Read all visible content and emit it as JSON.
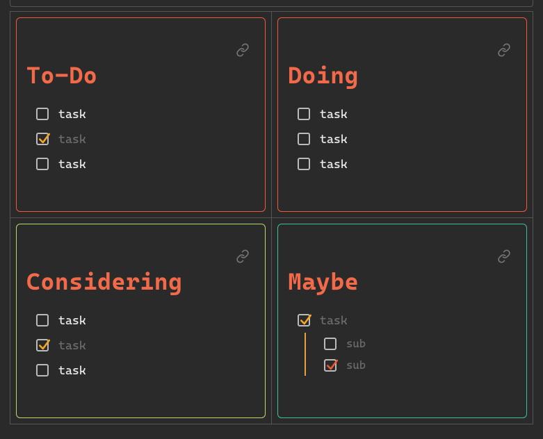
{
  "colors": {
    "accent_orange": "#f26a4a",
    "border_todo": "#f05a3a",
    "border_doing": "#f05a3a",
    "border_considering": "#b9d96a",
    "border_maybe": "#3fbfa0",
    "tick_orange": "#f5a623",
    "tick_red": "#e85a3a"
  },
  "icons": {
    "link": "link-icon"
  },
  "cards": {
    "todo": {
      "title": "To-Do",
      "tasks": [
        {
          "label": "task",
          "checked": false
        },
        {
          "label": "task",
          "checked": true
        },
        {
          "label": "task",
          "checked": false
        }
      ]
    },
    "doing": {
      "title": "Doing",
      "tasks": [
        {
          "label": "task",
          "checked": false
        },
        {
          "label": "task",
          "checked": false
        },
        {
          "label": "task",
          "checked": false
        }
      ]
    },
    "considering": {
      "title": "Considering",
      "tasks": [
        {
          "label": "task",
          "checked": false
        },
        {
          "label": "task",
          "checked": true
        },
        {
          "label": "task",
          "checked": false
        }
      ]
    },
    "maybe": {
      "title": "Maybe",
      "tasks": [
        {
          "label": "task",
          "checked": true,
          "subs": [
            {
              "label": "sub",
              "checked": false
            },
            {
              "label": "sub",
              "checked": true
            }
          ]
        }
      ]
    }
  }
}
